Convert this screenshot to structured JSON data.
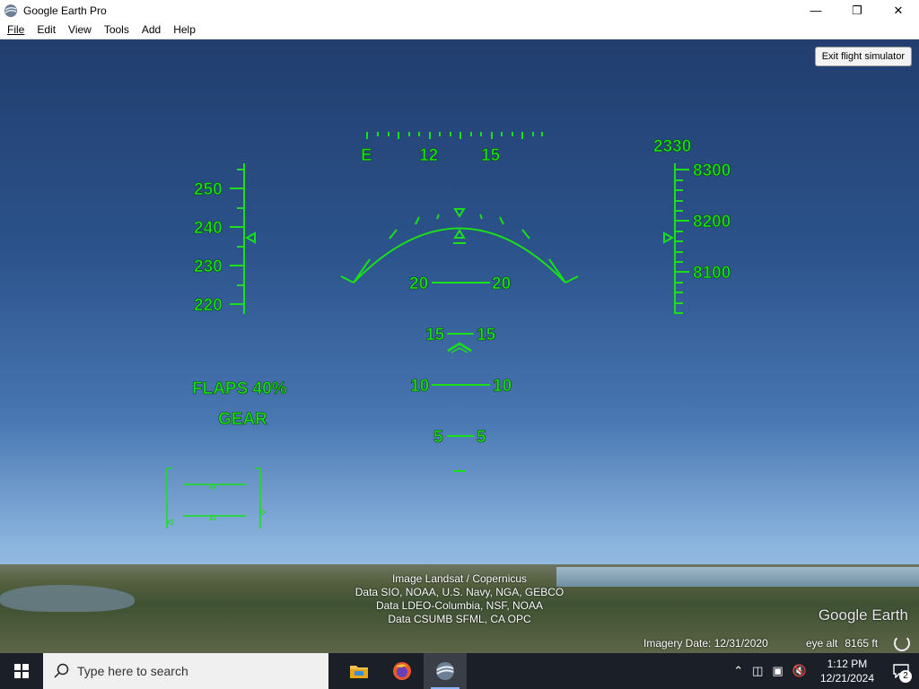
{
  "window": {
    "title": "Google Earth Pro"
  },
  "menu": [
    "File",
    "Edit",
    "View",
    "Tools",
    "Add",
    "Help"
  ],
  "controls": {
    "exit_label": "Exit flight simulator"
  },
  "hud": {
    "heading_labels": [
      "E",
      "12",
      "15"
    ],
    "airspeed_ticks": [
      "250",
      "240",
      "230",
      "220"
    ],
    "vertical_speed": "2330",
    "altitude_ticks": [
      "8300",
      "8200",
      "8100"
    ],
    "pitch": {
      "p20": "20",
      "p15": "15",
      "p10": "10",
      "p5": "5"
    },
    "flaps": "FLAPS 40%",
    "gear": "GEAR"
  },
  "attribution": [
    "Image Landsat / Copernicus",
    "Data SIO, NOAA, U.S. Navy, NGA, GEBCO",
    "Data LDEO-Columbia, NSF, NOAA",
    "Data CSUMB SFML, CA OPC"
  ],
  "brand": "Google Earth",
  "status": {
    "imagery_date": "Imagery Date: 12/31/2020",
    "eye_alt_label": "eye alt",
    "eye_alt_value": "8165 ft"
  },
  "taskbar": {
    "search_placeholder": "Type here to search",
    "time": "1:12 PM",
    "date": "12/21/2024",
    "notification_count": "2"
  }
}
